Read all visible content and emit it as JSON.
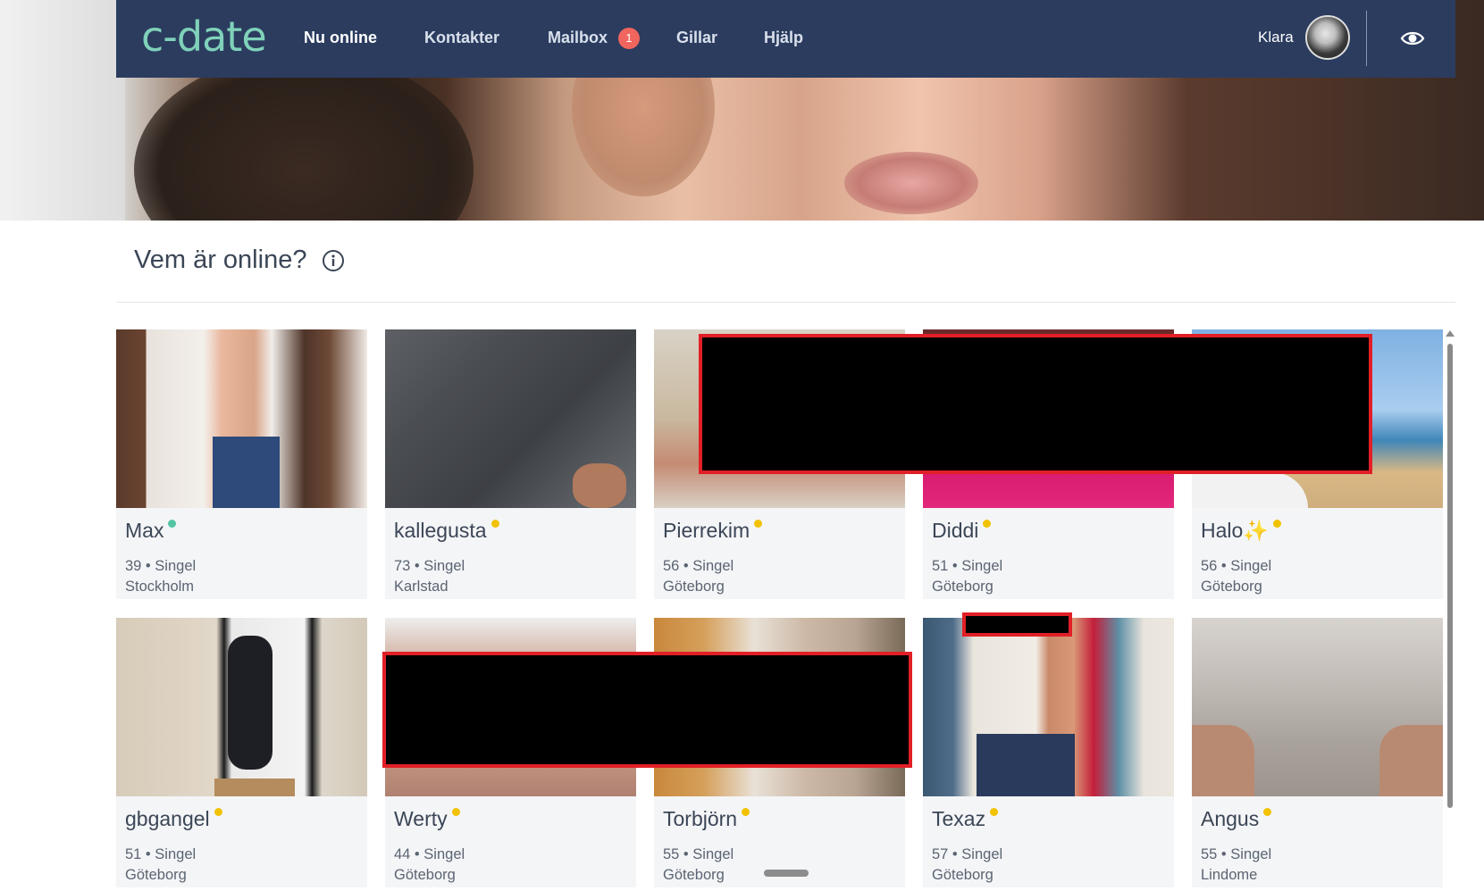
{
  "nav": {
    "logo": "c-date",
    "items": [
      {
        "label": "Nu online",
        "active": true
      },
      {
        "label": "Kontakter",
        "active": false
      },
      {
        "label": "Mailbox",
        "active": false
      },
      {
        "label": "Gillar",
        "active": false
      },
      {
        "label": "Hjälp",
        "active": false
      }
    ],
    "mailbox_badge": "1",
    "user_name": "Klara",
    "visibility_icon": "eye-icon"
  },
  "section": {
    "title": "Vem är online?",
    "info_icon": "info-icon"
  },
  "colors": {
    "navbar": "#2b3c5f",
    "logo": "#7fd1b9",
    "badge": "#f0655e",
    "online_dot": "#55c4a4",
    "recent_dot": "#f2c200",
    "card_bg": "#f4f5f7"
  },
  "profiles": [
    {
      "name": "Max",
      "status": "online",
      "meta": "39 • Singel",
      "city": "Stockholm"
    },
    {
      "name": "kallegusta",
      "status": "recent",
      "meta": "73 • Singel",
      "city": "Karlstad"
    },
    {
      "name": "Pierrekim",
      "status": "recent",
      "meta": "56 • Singel",
      "city": "Göteborg"
    },
    {
      "name": "Diddi",
      "status": "recent",
      "meta": "51 • Singel",
      "city": "Göteborg"
    },
    {
      "name": "Halo✨",
      "status": "recent",
      "meta": "56 • Singel",
      "city": "Göteborg"
    },
    {
      "name": "gbgangel",
      "status": "recent",
      "meta": "51 • Singel",
      "city": "Göteborg"
    },
    {
      "name": "Werty",
      "status": "recent",
      "meta": "44 • Singel",
      "city": "Göteborg"
    },
    {
      "name": "Torbjörn",
      "status": "recent",
      "meta": "55 • Singel",
      "city": "Göteborg"
    },
    {
      "name": "Texaz",
      "status": "recent",
      "meta": "57 • Singel",
      "city": "Göteborg"
    },
    {
      "name": "Angus",
      "status": "recent",
      "meta": "55 • Singel",
      "city": "Lindome"
    }
  ]
}
